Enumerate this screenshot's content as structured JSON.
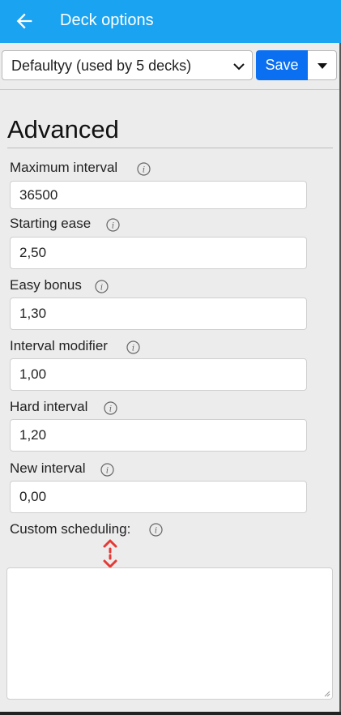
{
  "appbar": {
    "title": "Deck options"
  },
  "preset": {
    "selected": "Defaultyy (used by 5 decks)",
    "save_label": "Save"
  },
  "section": {
    "title": "Advanced"
  },
  "fields": [
    {
      "label": "Maximum interval",
      "value": "36500"
    },
    {
      "label": "Starting ease",
      "value": "2,50"
    },
    {
      "label": "Easy bonus",
      "value": "1,30"
    },
    {
      "label": "Interval modifier",
      "value": "1,00"
    },
    {
      "label": "Hard interval",
      "value": "1,20"
    },
    {
      "label": "New interval",
      "value": "0,00"
    }
  ],
  "custom_scheduling": {
    "label": "Custom scheduling:",
    "value": ""
  },
  "colors": {
    "appbar": "#1aa3f0",
    "save": "#0a6ff0",
    "handle": "#e53935"
  }
}
